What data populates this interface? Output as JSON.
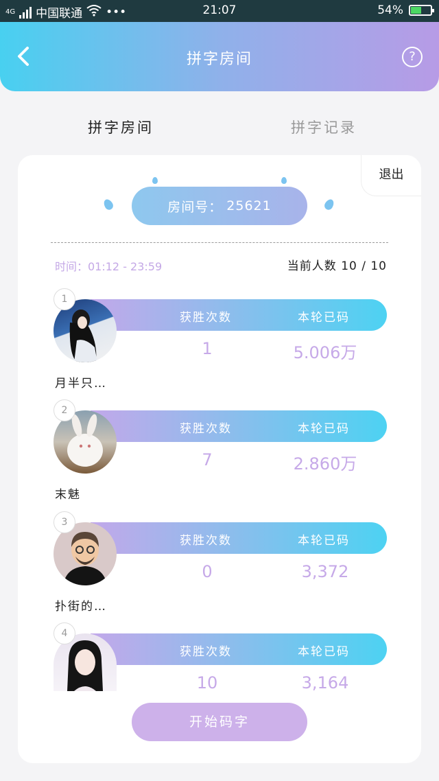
{
  "status_bar": {
    "network": "4G",
    "carrier": "中国联通",
    "more": "•••",
    "time": "21:07",
    "battery": "54%",
    "battery_level": 0.54
  },
  "header": {
    "title": "拼字房间",
    "help": "?"
  },
  "tabs": [
    {
      "label": "拼字房间",
      "active": true
    },
    {
      "label": "拼字记录",
      "active": false
    }
  ],
  "card": {
    "exit_label": "退出",
    "room_label": "房间号：",
    "room_number": "25621",
    "time_label": "时间：01:12 - 23:59",
    "count_label": "当前人数 10 / 10"
  },
  "columns": {
    "wins": "获胜次数",
    "code": "本轮已码"
  },
  "players": [
    {
      "rank": "1",
      "name": "月半只…",
      "wins": "1",
      "code": "5.006万"
    },
    {
      "rank": "2",
      "name": "末魅",
      "wins": "7",
      "code": "2.860万"
    },
    {
      "rank": "3",
      "name": "扑街的…",
      "wins": "0",
      "code": "3,372"
    },
    {
      "rank": "4",
      "name": "",
      "wins": "10",
      "code": "3,164"
    }
  ],
  "start_button": "开始码字",
  "colors": {
    "accent_cyan": "#4dd2f2",
    "accent_purple": "#c2a8ea",
    "value_text": "#c6a9e8"
  }
}
